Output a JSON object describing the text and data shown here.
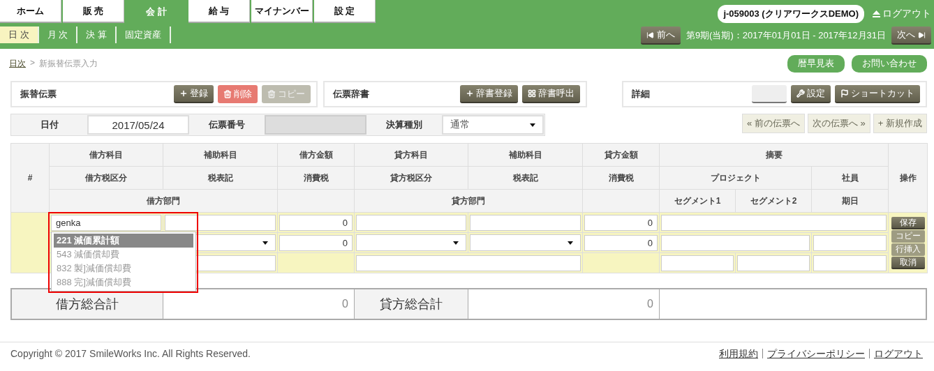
{
  "top_tabs": [
    {
      "label": "ホーム",
      "selected": false
    },
    {
      "label": "販 売",
      "selected": false
    },
    {
      "label": "会 計",
      "selected": true
    },
    {
      "label": "給 与",
      "selected": false
    },
    {
      "label": "マイナンバー",
      "selected": false
    },
    {
      "label": "設 定",
      "selected": false
    }
  ],
  "sub_tabs": [
    {
      "label": "日 次",
      "selected": true
    },
    {
      "label": "月 次",
      "selected": false
    },
    {
      "label": "決 算",
      "selected": false
    },
    {
      "label": "固定資産",
      "selected": false
    }
  ],
  "account": {
    "user": "j-059003 (クリアワークスDEMO)",
    "logout": "ログアウト"
  },
  "period": {
    "prev": "前へ",
    "text": "第9期(当期)：2017年01月01日 - 2017年12月31日",
    "next": "次へ"
  },
  "breadcrumb": {
    "link": "日次",
    "separator": ">",
    "current": "新振替伝票入力"
  },
  "header_buttons": [
    "暦早見表",
    "お問い合わせ"
  ],
  "panels": [
    {
      "title": "振替伝票",
      "buttons": [
        {
          "label": "登録",
          "kind": "primary"
        },
        {
          "label": "削除",
          "kind": "danger"
        },
        {
          "label": "コピー",
          "kind": "muted"
        }
      ]
    },
    {
      "title": "伝票辞書",
      "buttons": [
        {
          "label": "辞書登録",
          "kind": "primary"
        },
        {
          "label": "辞書呼出",
          "kind": "primary"
        }
      ]
    },
    {
      "title": "詳細",
      "buttons": [
        {
          "kind": "blank"
        },
        {
          "label": "設定",
          "kind": "primary"
        },
        {
          "label": "ショートカット",
          "kind": "primary"
        }
      ]
    }
  ],
  "voucher": {
    "date_label": "日付",
    "date": "2017/05/24",
    "number_label": "伝票番号",
    "type_label": "決算種別",
    "type": "通常"
  },
  "voucher_nav": [
    "« 前の伝票へ",
    "次の伝票へ »",
    "+ 新規作成"
  ],
  "header": {
    "number": "#",
    "row_1": [
      "借方科目",
      "補助科目",
      "借方金額",
      "貸方科目",
      "補助科目",
      "貸方金額",
      "摘要"
    ],
    "row_2": [
      "借方税区分",
      "税表記",
      "消費税",
      "貸方税区分",
      "税表記",
      "消費税",
      "プロジェクト",
      "社員"
    ],
    "row_3": [
      "借方部門",
      "貸方部門",
      "セグメント1",
      "セグメント2",
      "期日"
    ],
    "actions": "操作"
  },
  "entry": {
    "debit_account": "genka",
    "debit_amount": "0",
    "credit_amount": "0",
    "debit_tax": "0",
    "credit_tax": "0"
  },
  "account_suggestions": [
    {
      "label": "221 減価累計額",
      "selected": true
    },
    {
      "label": "543 減価償却費",
      "selected": false
    },
    {
      "label": "832 製]減価償却費",
      "selected": false
    },
    {
      "label": "888 完]減価償却費",
      "selected": false
    }
  ],
  "row_actions": [
    {
      "label": "保存",
      "disabled": false
    },
    {
      "label": "コピー",
      "disabled": true
    },
    {
      "label": "行挿入",
      "disabled": true
    },
    {
      "label": "取消",
      "disabled": false
    }
  ],
  "totals": [
    {
      "label": "借方総合計",
      "value": "0"
    },
    {
      "label": "貸方総合計",
      "value": "0"
    }
  ],
  "footer": {
    "copyright": "Copyright © 2017 SmileWorks Inc. All Rights Reserved.",
    "links": [
      "利用規約",
      "プライバシーポリシー",
      "ログアウト"
    ]
  }
}
